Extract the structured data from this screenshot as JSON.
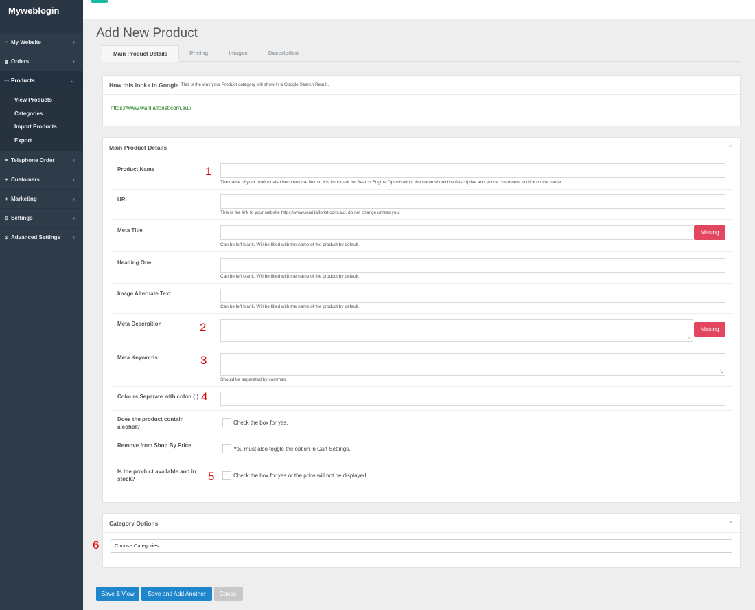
{
  "brand": "Myweblogin",
  "page_title": "Add New Product",
  "nav": {
    "my_website": "My Website",
    "orders": "Orders",
    "products": "Products",
    "products_sub": [
      "View Products",
      "Categories",
      "Import Products",
      "Export"
    ],
    "telephone_order": "Telephone Order",
    "customers": "Customers",
    "marketing": "Marketing",
    "settings": "Settings",
    "advanced_settings": "Advanced Settings"
  },
  "tabs": [
    "Main Product Details",
    "Pricing",
    "Images",
    "Description"
  ],
  "google": {
    "title": "How this looks in Google",
    "subtitle": "This is the way your Product category will show in a Google Search Result.",
    "url": "https://www.warillaflorist.com.au//"
  },
  "main_panel": {
    "title": "Main Product Details",
    "fields": {
      "product_name": "Product Name",
      "product_name_help": "The name of your product also becomes the link so it is important for Search Engine Optimisation, the name should be descriptive and entice customers to click on the name.",
      "url": "URL",
      "url_help": "This is the link to your website https://www.warillaflorist.com.au/, do not change unless you",
      "meta_title": "Meta Title",
      "meta_title_help": "Can be left blank. Will be filled with the name of the product by default.",
      "heading_one": "Heading One",
      "heading_one_help": "Can be left blank. Will be filled with the name of the product by default.",
      "image_alt": "Image Alternate Text",
      "image_alt_help": "Can be left blank. Will be filled with the name of the product by default.",
      "meta_description": "Meta Descrpition",
      "meta_keywords": "Meta Keywords",
      "meta_keywords_help": "Should be separated by commas.",
      "colours": "Colours Separate with colon (:)",
      "alcohol": "Does the product contain alcohol?",
      "alcohol_check": "Check the box for yes.",
      "remove_shop": "Remove from Shop By Price",
      "remove_shop_check": "You must also toggle the option in Cart Settings.",
      "in_stock": "Is the product available and in stock?",
      "in_stock_check": "Check the box for yes or the price will not be displayed."
    },
    "missing_label": "Missing"
  },
  "category_panel": {
    "title": "Category Options",
    "placeholder": "Choose Categories..."
  },
  "annotations": [
    "1",
    "2",
    "3",
    "4",
    "5",
    "6"
  ],
  "buttons": {
    "save_view": "Save & View",
    "save_another": "Save and Add Another",
    "cancel": "Cancel"
  }
}
